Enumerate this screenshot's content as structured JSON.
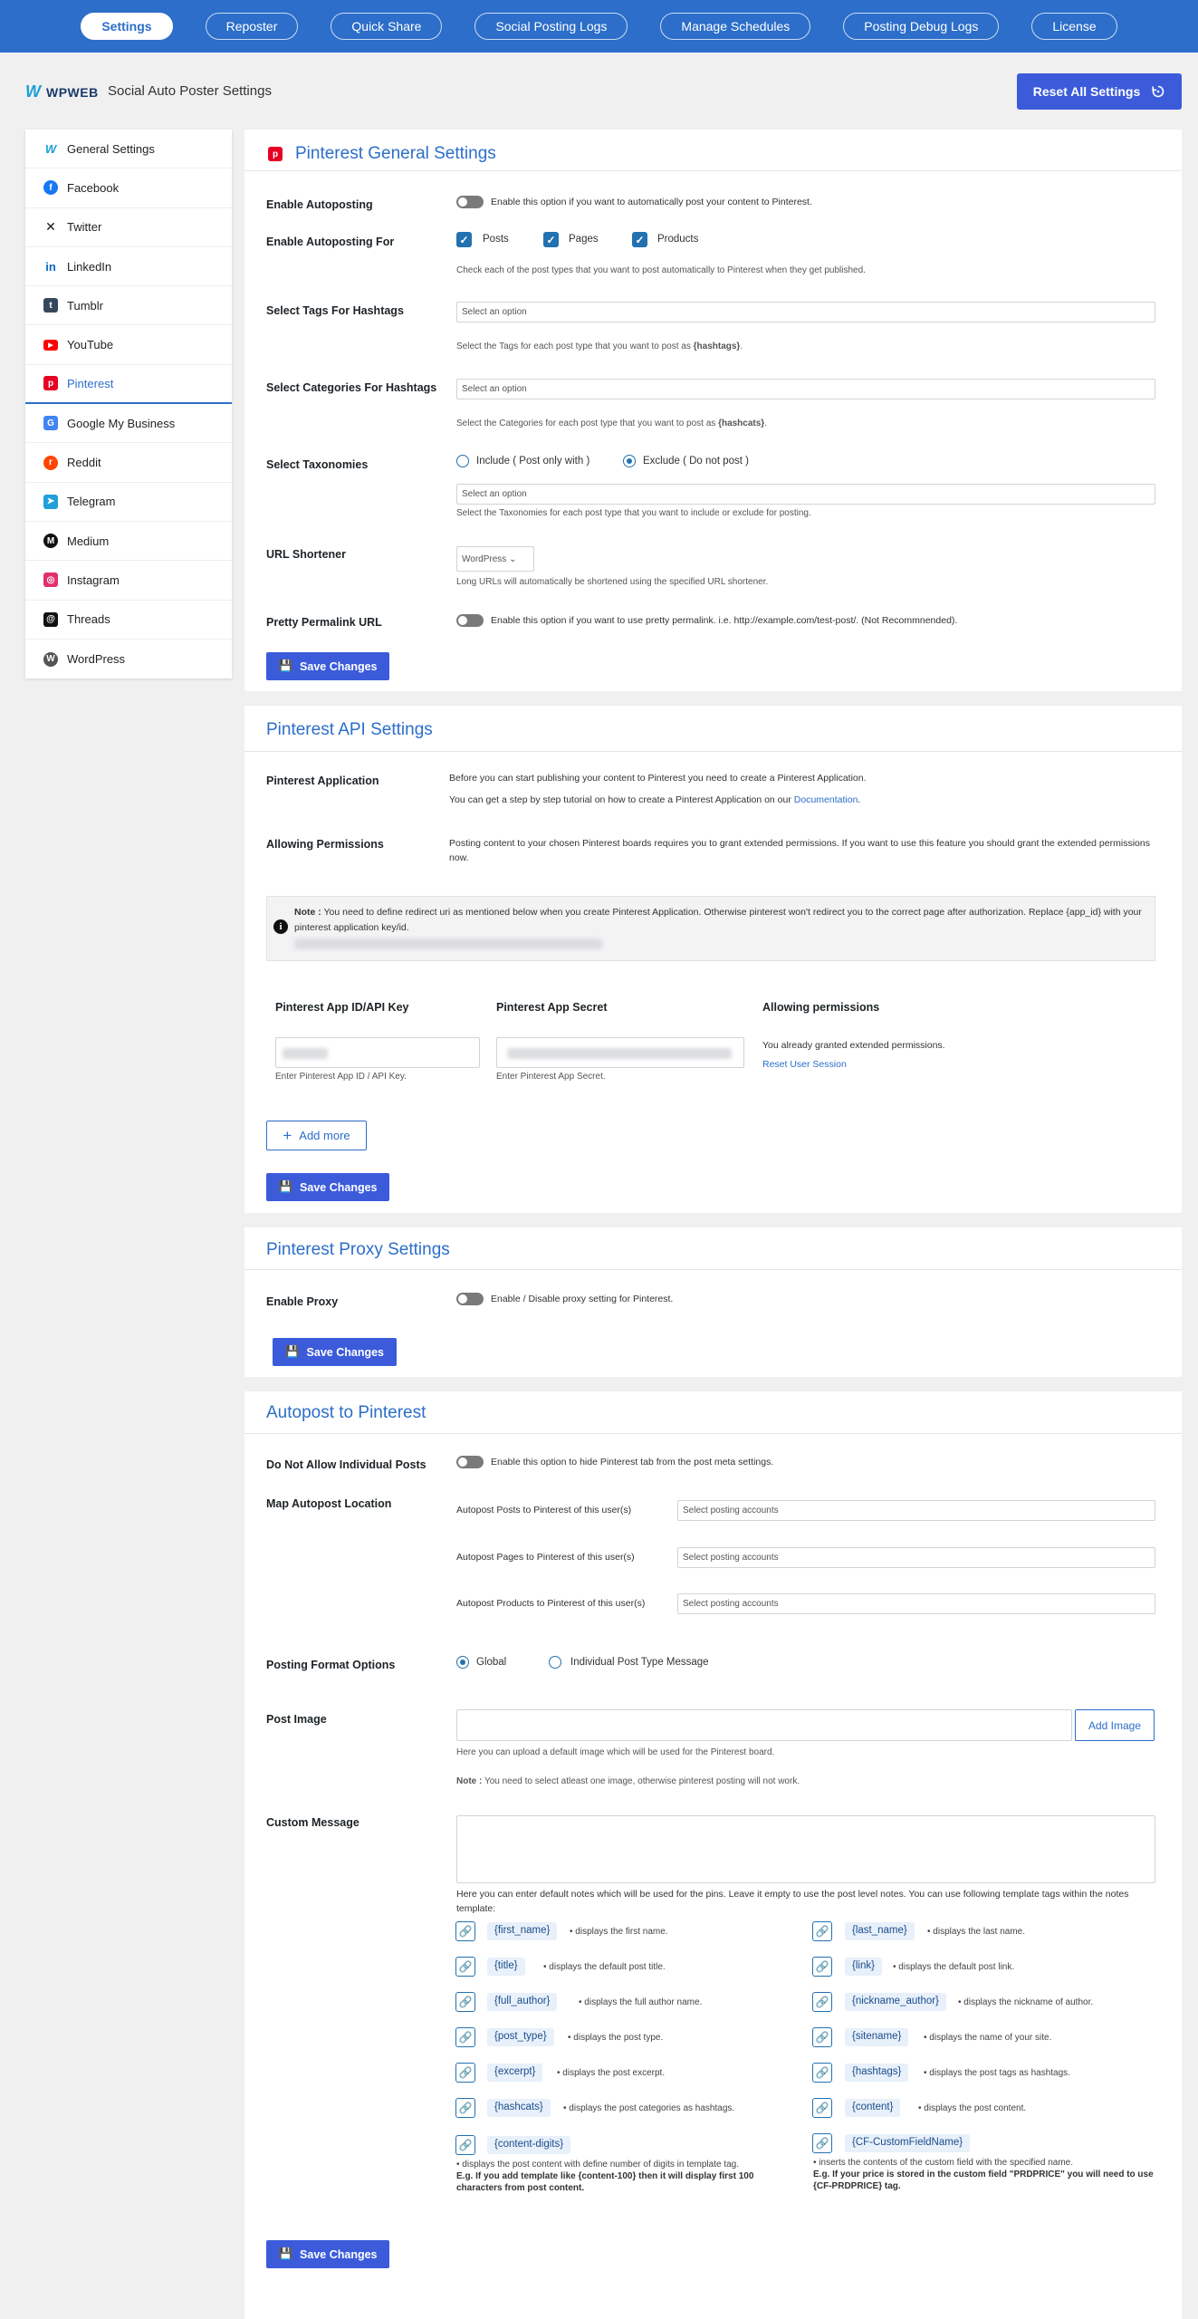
{
  "nav": {
    "tabs": [
      "Settings",
      "Reposter",
      "Quick Share",
      "Social Posting Logs",
      "Manage Schedules",
      "Posting Debug Logs",
      "License"
    ]
  },
  "header": {
    "logo_text": "WPWEB",
    "title": "Social Auto Poster Settings",
    "reset_label": "Reset All Settings"
  },
  "sidebar": {
    "items": [
      {
        "label": "General Settings",
        "icon": "wpweb-icon",
        "color": "#1a9fd6"
      },
      {
        "label": "Facebook",
        "icon": "facebook-icon",
        "color": "#1877f2"
      },
      {
        "label": "Twitter",
        "icon": "x-icon",
        "color": "#111111"
      },
      {
        "label": "LinkedIn",
        "icon": "linkedin-icon",
        "color": "#0a66c2"
      },
      {
        "label": "Tumblr",
        "icon": "tumblr-icon",
        "color": "#36465d"
      },
      {
        "label": "YouTube",
        "icon": "youtube-icon",
        "color": "#ff0000"
      },
      {
        "label": "Pinterest",
        "icon": "pinterest-icon",
        "color": "#e60023"
      },
      {
        "label": "Google My Business",
        "icon": "google-business-icon",
        "color": "#4285f4"
      },
      {
        "label": "Reddit",
        "icon": "reddit-icon",
        "color": "#ff4500"
      },
      {
        "label": "Telegram",
        "icon": "telegram-icon",
        "color": "#229ed9"
      },
      {
        "label": "Medium",
        "icon": "medium-icon",
        "color": "#111111"
      },
      {
        "label": "Instagram",
        "icon": "instagram-icon",
        "color": "#e1306c"
      },
      {
        "label": "Threads",
        "icon": "threads-icon",
        "color": "#111111"
      },
      {
        "label": "WordPress",
        "icon": "wordpress-icon",
        "color": "#555555"
      }
    ],
    "active_index": 6
  },
  "general": {
    "title": "Pinterest General Settings",
    "autoposting_label": "Enable Autoposting",
    "autoposting_desc": "Enable this option if you want to automatically post your content to Pinterest.",
    "for_label": "Enable Autoposting For",
    "post_types": [
      "Posts",
      "Pages",
      "Products"
    ],
    "for_hint": "Check each of the post types that you want to post automatically to Pinterest when they get published.",
    "tags_label": "Select Tags For Hashtags",
    "tags_placeholder": "Select an option",
    "tags_hint_pre": "Select the Tags for each post type that you want to post as ",
    "tags_hint_code": "{hashtags}",
    "tags_hint_post": ".",
    "cats_label": "Select Categories For Hashtags",
    "cats_placeholder": "Select an option",
    "cats_hint_pre": "Select the Categories for each post type that you want to post as ",
    "cats_hint_code": "{hashcats}",
    "cats_hint_post": ".",
    "tax_label": "Select Taxonomies",
    "tax_include": "Include ( Post only with )",
    "tax_exclude": "Exclude ( Do not post )",
    "tax_placeholder": "Select an option",
    "tax_hint": "Select the Taxonomies for each post type that you want to include or exclude for posting.",
    "shortener_label": "URL Shortener",
    "shortener_value": "WordPress",
    "shortener_hint": "Long URLs will automatically be shortened using the specified URL shortener.",
    "permalink_label": "Pretty Permalink URL",
    "permalink_desc": "Enable this option if you want to use pretty permalink. i.e. http://example.com/test-post/. (Not Recommnended).",
    "save_label": "Save Changes"
  },
  "api": {
    "title": "Pinterest API Settings",
    "app_label": "Pinterest Application",
    "app_text1": "Before you can start publishing your content to Pinterest you need to create a Pinterest Application.",
    "app_text2_pre": "You can get a step by step tutorial on how to create a Pinterest Application on our ",
    "app_text2_link": "Documentation",
    "app_text2_post": ".",
    "perm_label": "Allowing Permissions",
    "perm_text": "Posting content to your chosen Pinterest boards requires you to grant extended permissions. If you want to use this feature you should grant the extended permissions now.",
    "note_bold": "Note :",
    "note_text": " You need to define redirect uri as mentioned below when you create Pinterest Application. Otherwise pinterest won't redirect you to the correct page after authorization. Replace {app_id} with your pinterest application key/id.",
    "col_appid": "Pinterest App ID/API Key",
    "col_secret": "Pinterest App Secret",
    "col_perm": "Allowing permissions",
    "appid_hint": "Enter Pinterest App ID / API Key.",
    "secret_hint": "Enter Pinterest App Secret.",
    "granted_text": "You already granted extended permissions.",
    "reset_session": "Reset User Session",
    "add_more": "Add more",
    "save_label": "Save Changes"
  },
  "proxy": {
    "title": "Pinterest Proxy Settings",
    "enable_label": "Enable Proxy",
    "enable_desc": "Enable / Disable proxy setting for Pinterest.",
    "save_label": "Save Changes"
  },
  "autopost": {
    "title": "Autopost to Pinterest",
    "individual_label": "Do Not Allow Individual Posts",
    "individual_desc": "Enable this option to hide Pinterest tab from the post meta settings.",
    "map_label": "Map Autopost Location",
    "map_rows": [
      {
        "label": "Autopost Posts to Pinterest of this user(s)",
        "placeholder": "Select posting accounts"
      },
      {
        "label": "Autopost Pages to Pinterest of this user(s)",
        "placeholder": "Select posting accounts"
      },
      {
        "label": "Autopost Products to Pinterest of this user(s)",
        "placeholder": "Select posting accounts"
      }
    ],
    "format_label": "Posting Format Options",
    "format_global": "Global",
    "format_individual": "Individual Post Type Message",
    "image_label": "Post Image",
    "add_image": "Add Image",
    "image_hint": "Here you can upload a default image which will be used for the Pinterest board.",
    "image_note_bold": "Note :",
    "image_note": " You need to select atleast one image, otherwise pinterest posting will not work.",
    "message_label": "Custom Message",
    "message_hint": "Here you can enter default notes which will be used for the pins. Leave it empty to use the post level notes. You can use following template tags within the notes template:",
    "tags_left": [
      {
        "tag": "{first_name}",
        "desc": "displays the first name."
      },
      {
        "tag": "{title}",
        "desc": "displays the default post title."
      },
      {
        "tag": "{full_author}",
        "desc": "displays the full author name."
      },
      {
        "tag": "{post_type}",
        "desc": "displays the post type."
      },
      {
        "tag": "{excerpt}",
        "desc": "displays the post excerpt."
      },
      {
        "tag": "{hashcats}",
        "desc": "displays the post categories as hashtags."
      }
    ],
    "tags_right": [
      {
        "tag": "{last_name}",
        "desc": "displays the last name."
      },
      {
        "tag": "{link}",
        "desc": "displays the default post link."
      },
      {
        "tag": "{nickname_author}",
        "desc": "displays the nickname of author."
      },
      {
        "tag": "{sitename}",
        "desc": "displays the name of your site."
      },
      {
        "tag": "{hashtags}",
        "desc": "displays the post tags as hashtags."
      },
      {
        "tag": "{content}",
        "desc": "displays the post content."
      }
    ],
    "digits_tag": "{content-digits}",
    "digits_desc": "displays the post content with define number of digits in template tag.",
    "digits_eg": "E.g. If you add template like {content-100} then it will display first 100 characters from post content.",
    "cf_tag": "{CF-CustomFieldName}",
    "cf_desc": "inserts the contents of the custom field with the specified name.",
    "cf_eg": "E.g. If your price is stored in the custom field \"PRDPRICE\" you will need to use {CF-PRDPRICE} tag.",
    "save_label": "Save Changes"
  }
}
